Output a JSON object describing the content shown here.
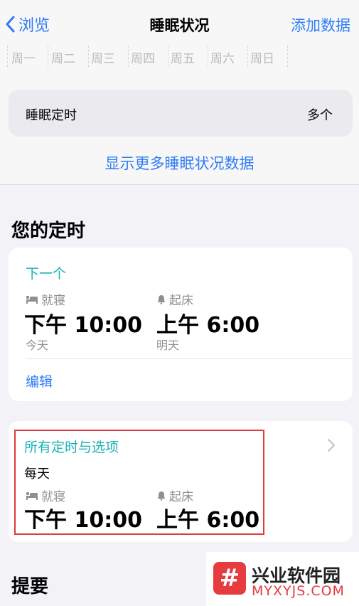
{
  "nav": {
    "back_label": "浏览",
    "title": "睡眠状况",
    "action_label": "添加数据"
  },
  "weekdays": [
    "周一",
    "周二",
    "周三",
    "周四",
    "周五",
    "周六",
    "周日"
  ],
  "schedule": {
    "label": "睡眠定时",
    "value": "多个"
  },
  "more_link": "显示更多睡眠状况数据",
  "your_schedule": {
    "title": "您的定时",
    "next": {
      "heading": "下一个",
      "bedtime_label": "就寝",
      "bedtime_value": "下午 10:00",
      "bedtime_day": "今天",
      "wake_label": "起床",
      "wake_value": "上午 6:00",
      "wake_day": "明天",
      "edit_label": "编辑"
    },
    "all": {
      "heading": "所有定时与选项",
      "frequency": "每天",
      "bedtime_label": "就寝",
      "bedtime_value": "下午 10:00",
      "wake_label": "起床",
      "wake_value": "上午 6:00"
    }
  },
  "summary_title": "提要",
  "watermark": {
    "logo_glyph": "#",
    "name": "兴业软件园",
    "url": "MYXYJS.COM"
  },
  "colors": {
    "accent": "#2f7cf6",
    "teal": "#17b2b8",
    "highlight": "#e0393e"
  },
  "icons": [
    "chevron-left-icon",
    "bed-icon",
    "bell-icon",
    "chevron-right-icon"
  ]
}
